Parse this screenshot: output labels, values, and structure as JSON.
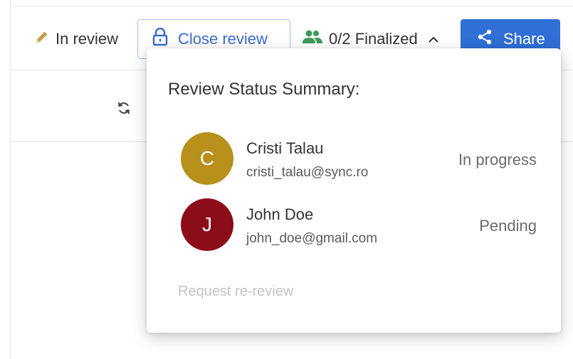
{
  "toolbar": {
    "status_label": "In review",
    "close_review_label": "Close review",
    "finalized_label": "0/2 Finalized",
    "share_label": "Share"
  },
  "popover": {
    "title": "Review Status Summary:",
    "reviewers": [
      {
        "initial": "C",
        "name": "Cristi Talau",
        "email": "cristi_talau@sync.ro",
        "status": "In progress",
        "avatar_color": "#b8901c"
      },
      {
        "initial": "J",
        "name": "John Doe",
        "email": "john_doe@gmail.com",
        "status": "Pending",
        "avatar_color": "#8c0d1a"
      }
    ],
    "request_rereview_label": "Request re-review"
  },
  "icons": {
    "status": "pencil-icon",
    "close_review": "lock-icon",
    "finalized": "people-icon",
    "expand": "chevron-up-icon",
    "share": "share-icon",
    "sync": "sync-icon"
  },
  "colors": {
    "accent": "#2f6fd6",
    "close_review_text": "#3a6cc8",
    "people_icon": "#3e9a5a",
    "pencil_icon": "#c69a4a"
  }
}
